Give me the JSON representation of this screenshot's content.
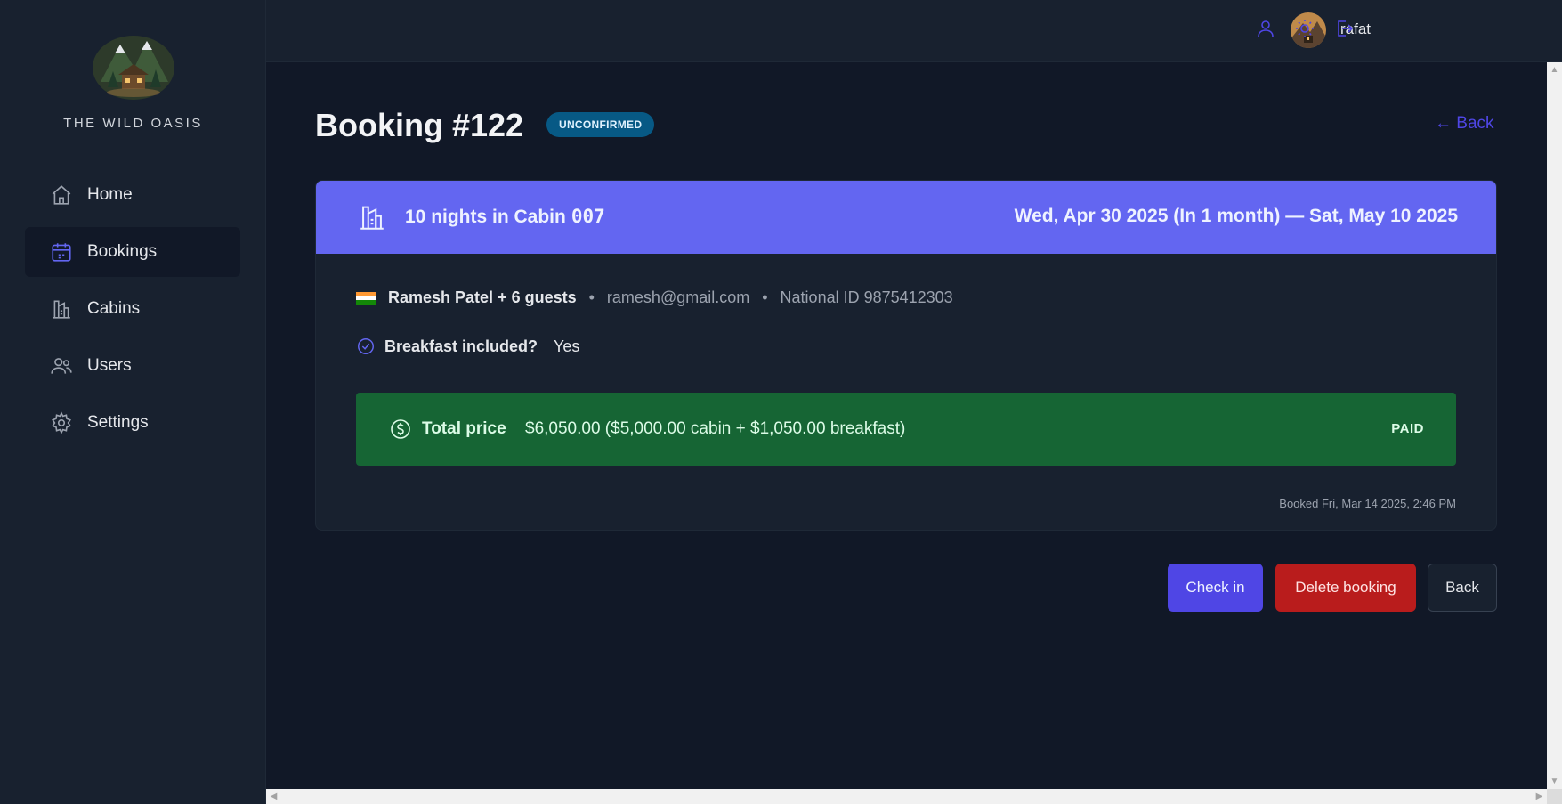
{
  "brand": {
    "name": "THE WILD OASIS"
  },
  "sidebar": {
    "items": [
      {
        "label": "Home",
        "icon": "home-icon"
      },
      {
        "label": "Bookings",
        "icon": "calendar-icon",
        "active": true
      },
      {
        "label": "Cabins",
        "icon": "cabin-icon"
      },
      {
        "label": "Users",
        "icon": "users-icon"
      },
      {
        "label": "Settings",
        "icon": "gear-icon"
      }
    ]
  },
  "header": {
    "username": "rafat",
    "buttons": [
      "user-icon",
      "sun-icon",
      "logout-icon"
    ]
  },
  "page": {
    "title": "Booking #122",
    "status": "UNCONFIRMED",
    "back_link": "← Back"
  },
  "booking": {
    "nights_text": "10 nights in Cabin",
    "cabin_code": "007",
    "date_range": "Wed, Apr 30 2025 (In 1 month) — Sat, May 10 2025",
    "guest": "Ramesh Patel + 6 guests",
    "email": "ramesh@gmail.com",
    "national_id": "National ID 9875412303",
    "separator": "•",
    "breakfast_label": "Breakfast included?",
    "breakfast_value": "Yes",
    "total_label": "Total price",
    "total_value": "$6,050.00 ($5,000.00 cabin + $1,050.00 breakfast)",
    "paid_status": "PAID",
    "booked_at": "Booked Fri, Mar 14 2025, 2:46 PM"
  },
  "actions": {
    "check_in": "Check in",
    "delete": "Delete booking",
    "back": "Back"
  },
  "colors": {
    "accent": "#6366f1",
    "primary_button": "#4f46e5",
    "danger": "#b91c1c",
    "paid_green": "#166534",
    "status_tag": "#075985"
  }
}
